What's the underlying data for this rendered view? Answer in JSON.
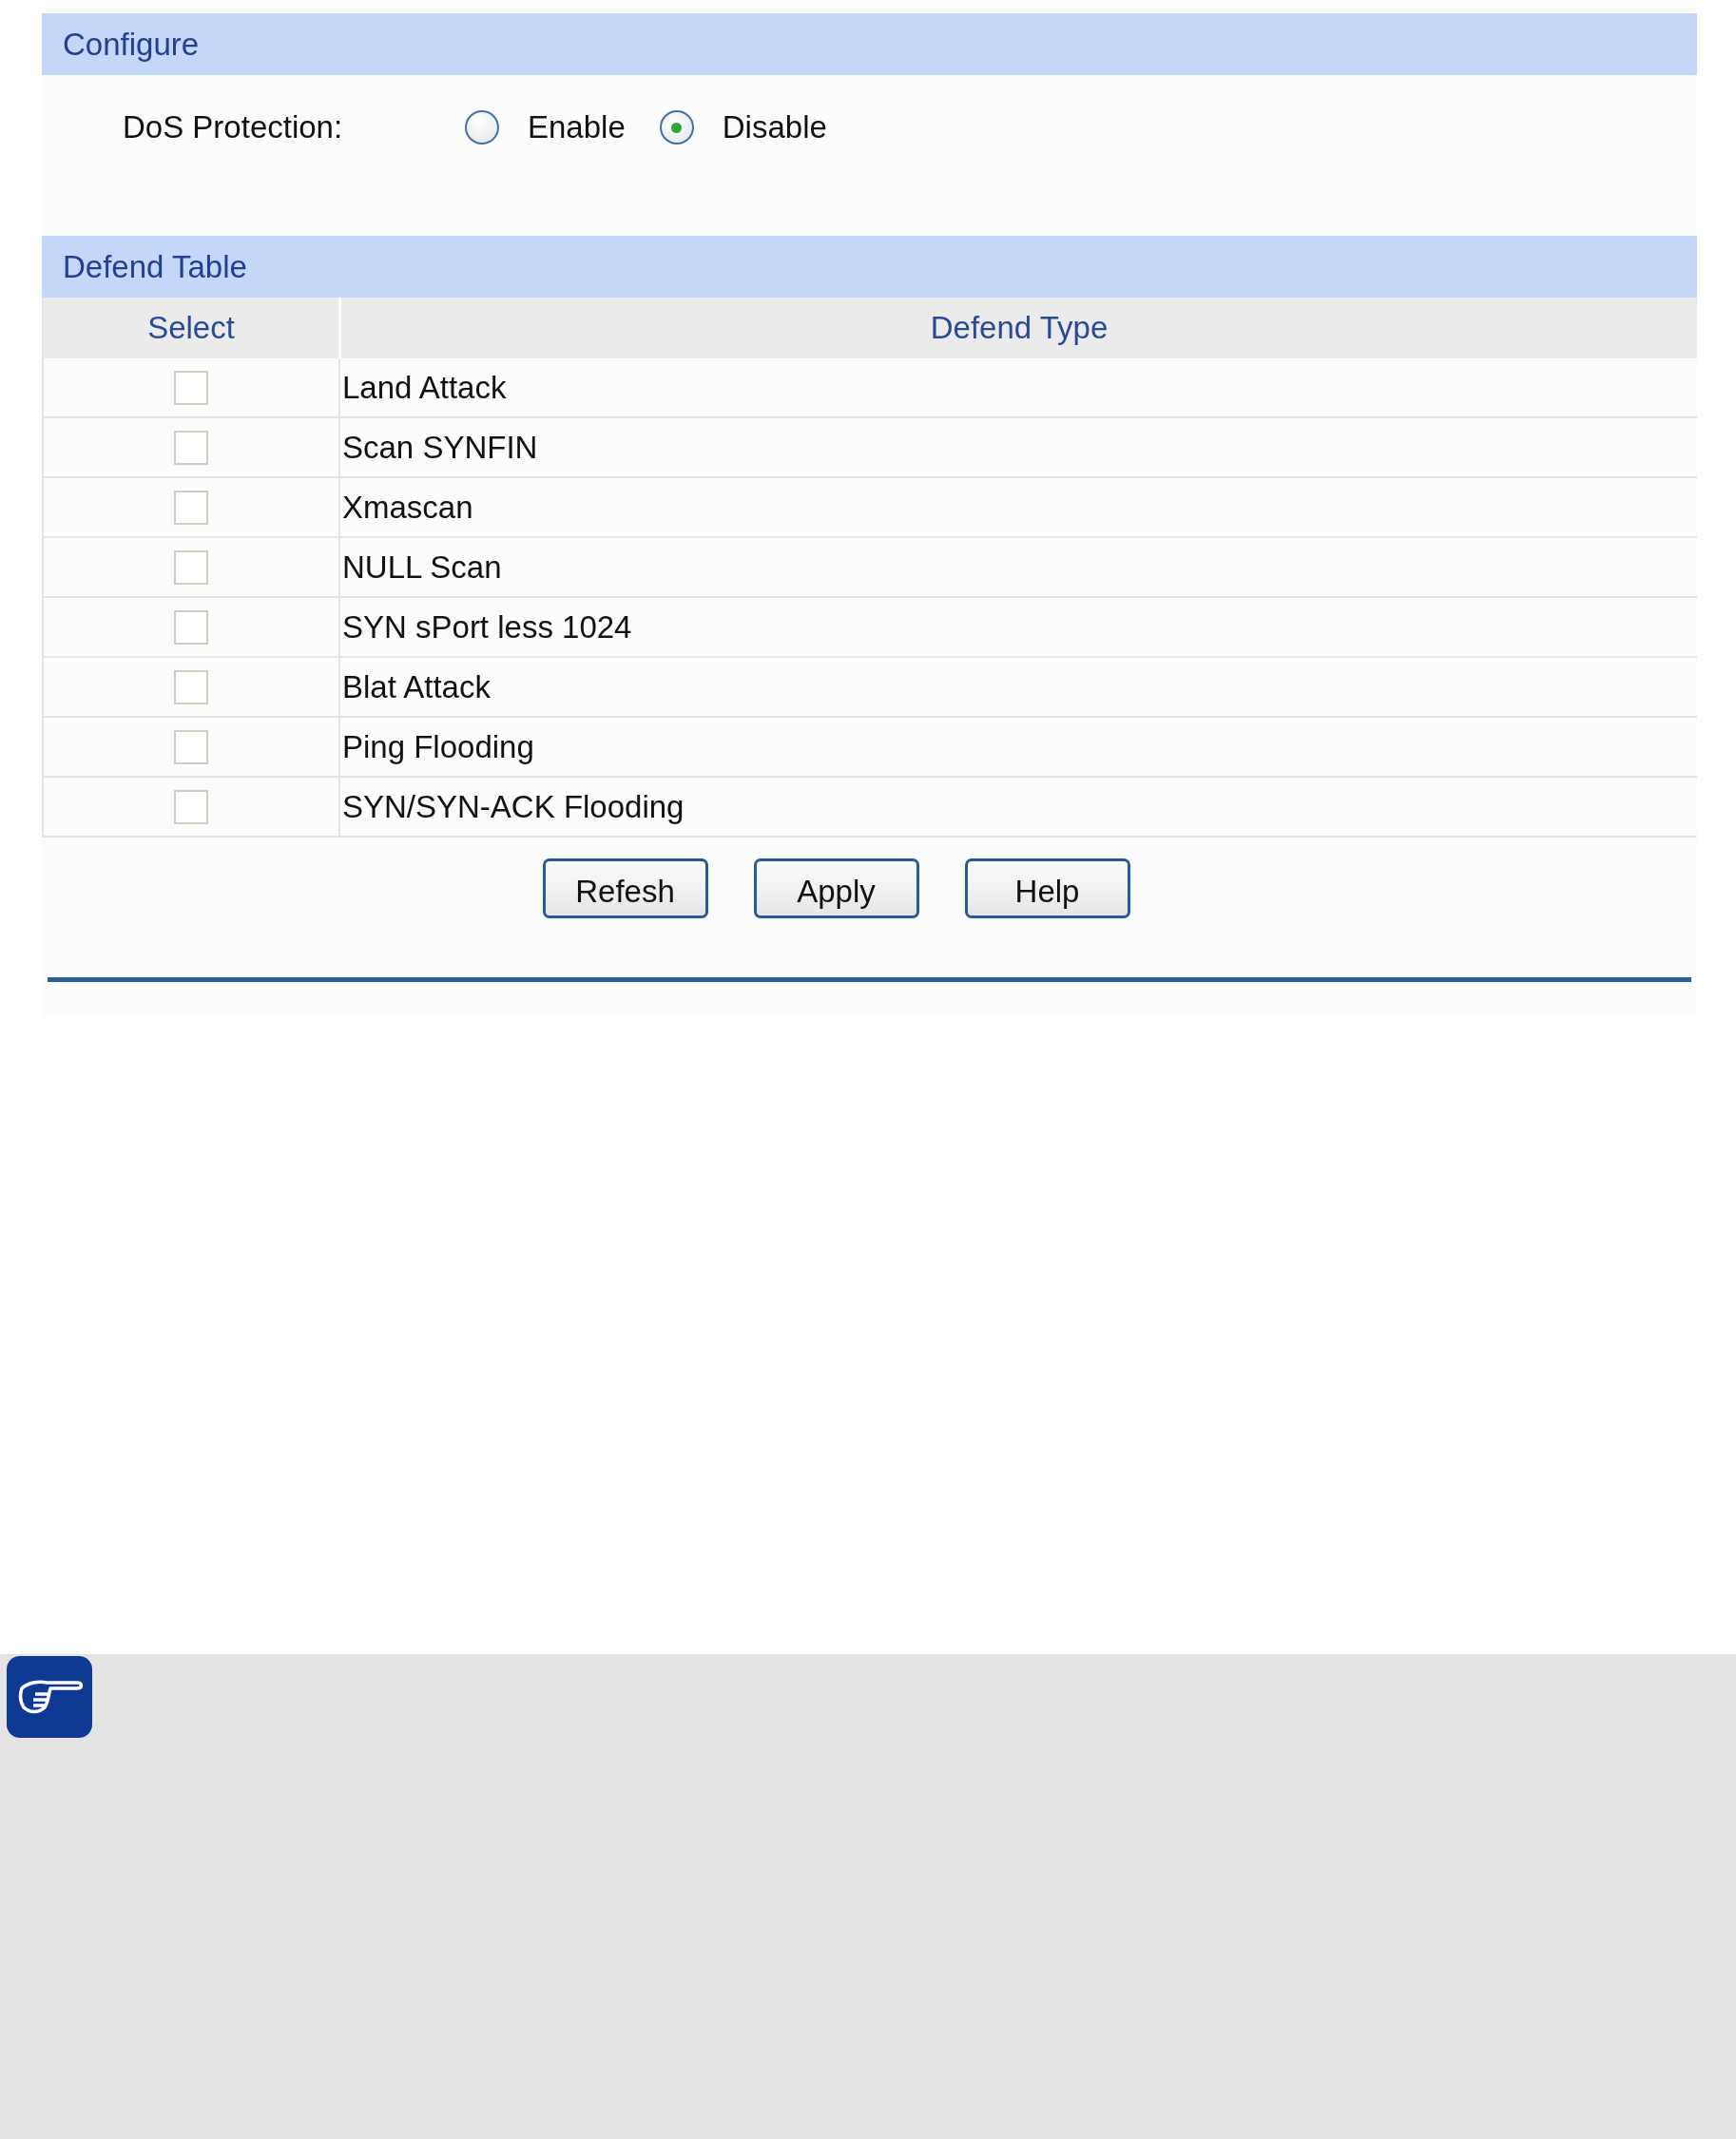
{
  "configure": {
    "title": "Configure",
    "dos_protection": {
      "label": "DoS Protection:",
      "options": [
        {
          "label": "Enable",
          "selected": false
        },
        {
          "label": "Disable",
          "selected": true
        }
      ]
    }
  },
  "defend_table": {
    "title": "Defend Table",
    "columns": [
      "Select",
      "Defend Type"
    ],
    "rows": [
      {
        "checked": false,
        "defend_type": "Land Attack"
      },
      {
        "checked": false,
        "defend_type": "Scan SYNFIN"
      },
      {
        "checked": false,
        "defend_type": "Xmascan"
      },
      {
        "checked": false,
        "defend_type": "NULL Scan"
      },
      {
        "checked": false,
        "defend_type": "SYN sPort less 1024"
      },
      {
        "checked": false,
        "defend_type": "Blat Attack"
      },
      {
        "checked": false,
        "defend_type": "Ping Flooding"
      },
      {
        "checked": false,
        "defend_type": "SYN/SYN-ACK Flooding"
      }
    ]
  },
  "buttons": [
    "Refesh",
    "Apply",
    "Help"
  ]
}
